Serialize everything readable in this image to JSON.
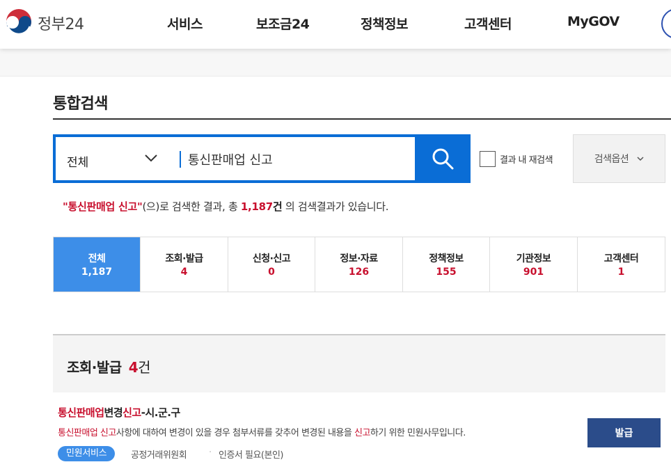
{
  "header": {
    "logo_text": "정부24",
    "nav": [
      "서비스",
      "보조금24",
      "정책정보",
      "고객센터",
      "MyGOV"
    ]
  },
  "page": {
    "title": "통합검색"
  },
  "search": {
    "scope": "전체",
    "query": "통신판매업 신고",
    "resubmit_label": "결과 내 재검색",
    "options_label": "검색옵션"
  },
  "summary": {
    "quote_open": "\"",
    "keyword": "통신판매업 신고",
    "quote_close": "\"",
    "text1": "(으)로 검색한 결과, 총 ",
    "total": "1,187",
    "unit": "건",
    "text2": " 의 검색결과가 있습니다."
  },
  "tabs": [
    {
      "label": "전체",
      "count": "1,187"
    },
    {
      "label": "조회·발급",
      "count": "4"
    },
    {
      "label": "신청·신고",
      "count": "0"
    },
    {
      "label": "정보·자료",
      "count": "126"
    },
    {
      "label": "정책정보",
      "count": "155"
    },
    {
      "label": "기관정보",
      "count": "901"
    },
    {
      "label": "고객센터",
      "count": "1"
    }
  ],
  "section": {
    "title": "조회·발급",
    "count": "4",
    "unit": "건"
  },
  "result": {
    "title_parts": [
      {
        "text": "통신판매업",
        "hl": true
      },
      {
        "text": "변경",
        "hl": false
      },
      {
        "text": "신고",
        "hl": true
      },
      {
        "text": "-시.군.구",
        "hl": false
      }
    ],
    "desc_parts": [
      {
        "text": "통신판매업 신고",
        "hl": true
      },
      {
        "text": "사항에 대하여 변경이 있을 경우 첨부서류를 갖추어 변경된 내용을 ",
        "hl": false
      },
      {
        "text": "신고",
        "hl": true
      },
      {
        "text": "하기 위한 민원사무입니다.",
        "hl": false
      }
    ],
    "tag": "민원서비스",
    "agency": "공정거래위원회",
    "cert": "인증서 필요(본인)",
    "action_label": "발급"
  },
  "colors": {
    "primary": "#0a6dd6",
    "active_tab": "#3d8ee8",
    "highlight": "#c8102e",
    "issue_button": "#2b4c8a"
  }
}
